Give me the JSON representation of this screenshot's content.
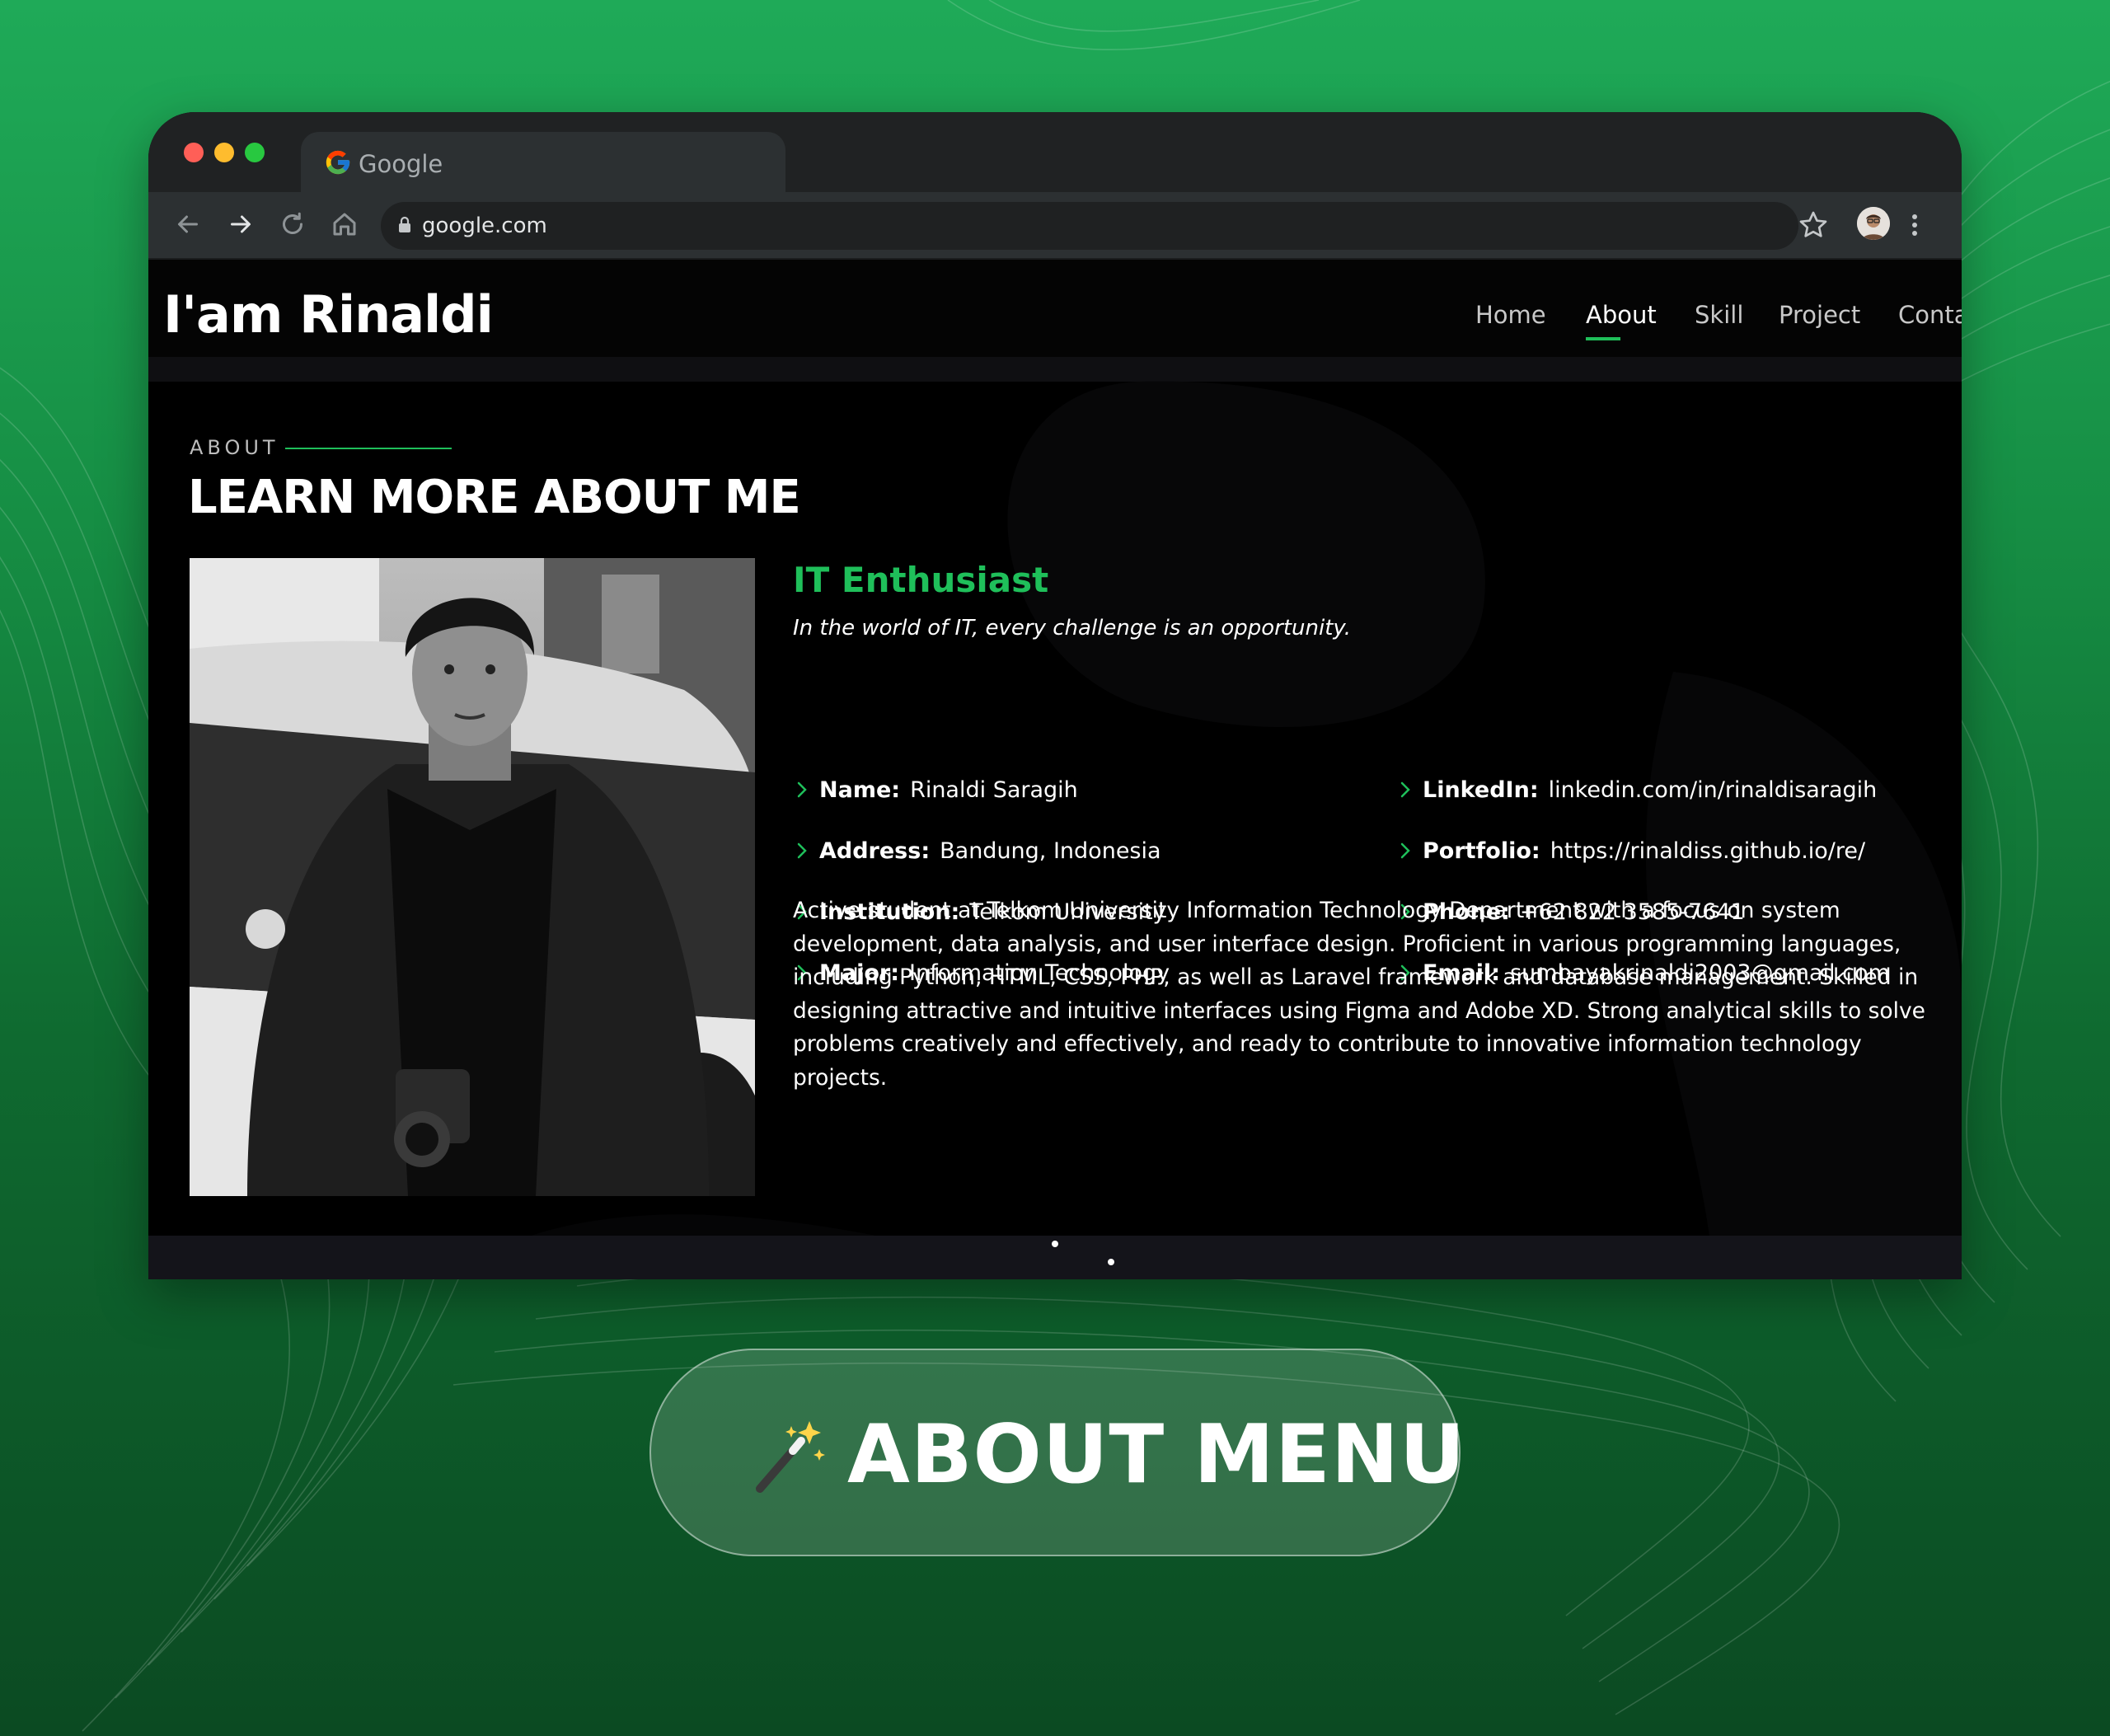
{
  "browser": {
    "tab_title": "Google",
    "url": "google.com"
  },
  "site": {
    "brand": "I'am Rinaldi",
    "nav": [
      {
        "label": "Home"
      },
      {
        "label": "About",
        "active": true
      },
      {
        "label": "Skill"
      },
      {
        "label": "Project"
      },
      {
        "label": "Conta"
      }
    ],
    "section": {
      "label": "ABOUT",
      "title": "LEARN MORE ABOUT ME"
    },
    "profile": {
      "role": "IT Enthusiast",
      "tagline": "In the world of IT, every challenge is an opportunity.",
      "left_info": [
        {
          "label": "Name:",
          "value": "Rinaldi Saragih"
        },
        {
          "label": "Address:",
          "value": "Bandung, Indonesia"
        },
        {
          "label": "Institution:",
          "value": "Telkom University"
        },
        {
          "label": "Major:",
          "value": "Information Technology"
        }
      ],
      "right_info": [
        {
          "label": "LinkedIn:",
          "value": "linkedin.com/in/rinaldisaragih"
        },
        {
          "label": "Portfolio:",
          "value": "https://rinaldiss.github.io/re/"
        },
        {
          "label": "Phone:",
          "value": "+62 822 3585-7641"
        },
        {
          "label": "Email:",
          "value": "sumbayakrinaldi2003@gmail.com"
        }
      ],
      "bio": "Active student at Telkom University Information Technology Department with a focus on system development, data analysis, and user interface design. Proficient in various programming languages, including Python, HTML, CSS, PHP, as well as Laravel framework and database management. Skilled in designing attractive and intuitive interfaces using Figma and Adobe XD. Strong analytical skills to solve problems creatively and effectively, and ready to contribute to innovative information technology projects."
    }
  },
  "banner": {
    "label": "ABOUT MENU"
  },
  "colors": {
    "accent": "#1fbf5a",
    "background_green": "#1faa58",
    "site_background": "#000000"
  },
  "icons": [
    "back-arrow-icon",
    "forward-arrow-icon",
    "reload-icon",
    "home-icon",
    "lock-icon",
    "star-icon",
    "avatar",
    "kebab-menu-icon",
    "google-logo",
    "chevron-right-icon",
    "magic-wand-icon"
  ]
}
